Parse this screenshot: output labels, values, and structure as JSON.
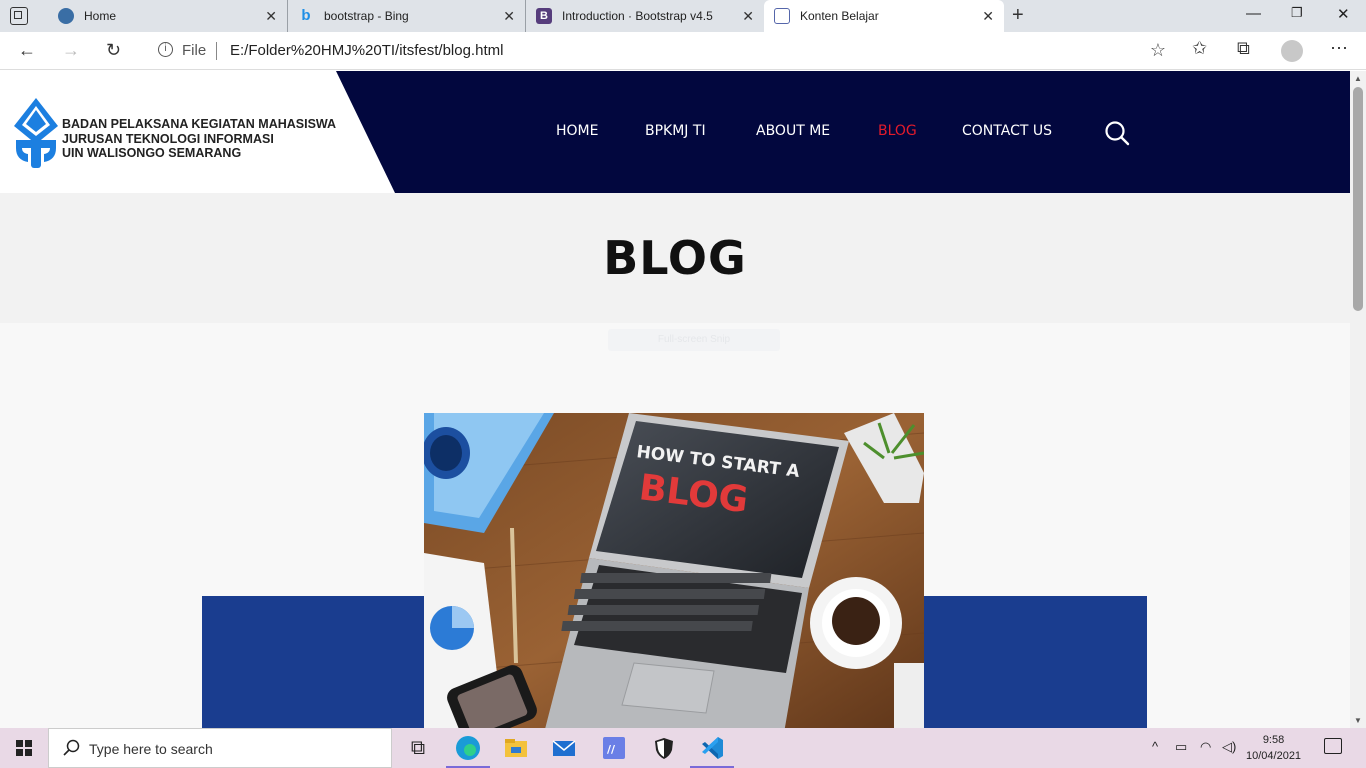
{
  "browser": {
    "tabs": [
      {
        "title": "Home",
        "favicon": "edge-icon"
      },
      {
        "title": "bootstrap - Bing",
        "favicon": "bing-icon"
      },
      {
        "title": "Introduction · Bootstrap v4.5",
        "favicon": "bootstrap-icon"
      },
      {
        "title": "Konten Belajar",
        "favicon": "page-icon",
        "active": true
      }
    ],
    "address": {
      "scheme_label": "File",
      "url": "E:/Folder%20HMJ%20TI/itsfest/blog.html"
    }
  },
  "site": {
    "logo_lines": [
      "BADAN PELAKSANA KEGIATAN MAHASISWA",
      "JURUSAN TEKNOLOGI INFORMASI",
      "UIN WALISONGO SEMARANG"
    ],
    "logo_caption": "TEKNOLOGI INFORMASI",
    "nav": [
      {
        "label": "HOME"
      },
      {
        "label": "BPKMJ TI"
      },
      {
        "label": "ABOUT ME"
      },
      {
        "label": "BLOG",
        "active": true
      },
      {
        "label": "CONTACT US"
      }
    ],
    "page_title": "BLOG",
    "snip_overlay": "Full-screen Snip",
    "hero_image": {
      "screen_line1": "HOW TO START A",
      "screen_line2": "BLOG"
    },
    "colors": {
      "header_bg": "#02073e",
      "nav_active": "#e31b2b",
      "blue_block": "#1a3d8f"
    }
  },
  "taskbar": {
    "search_placeholder": "Type here to search",
    "time": "9:58",
    "date": "10/04/2021"
  }
}
